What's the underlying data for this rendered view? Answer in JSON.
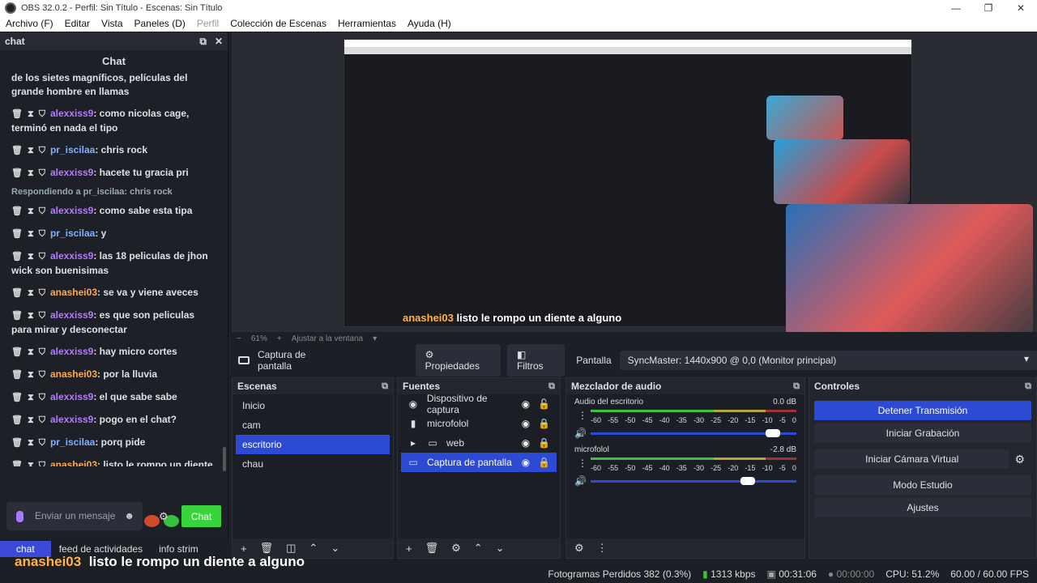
{
  "window": {
    "title": "OBS 32.0.2 - Perfil: Sin Título - Escenas: Sin Título",
    "controls": [
      "—",
      "❐",
      "✕"
    ]
  },
  "menu": [
    "Archivo (F)",
    "Editar",
    "Vista",
    "Paneles (D)",
    "Perfil",
    "Colección de Escenas",
    "Herramientas",
    "Ayuda (H)"
  ],
  "chat": {
    "dock_title": "chat",
    "title": "Chat",
    "messages": [
      {
        "user": "",
        "text": "de los sietes magníficos, películas del grande hombre en llamas"
      },
      {
        "user": "alexxiss9",
        "text": ": como nicolas cage, terminó en nada el tipo",
        "color": "u1"
      },
      {
        "user": "pr_iscilaa",
        "text": ": chris rock",
        "color": "u2"
      },
      {
        "user": "alexxiss9",
        "text": ": hacete tu gracia pri",
        "color": "u1"
      },
      {
        "user": "alexxiss9",
        "text": ": como sabe esta tipa",
        "color": "u1",
        "reply": "Respondiendo a pr_iscilaa: chris rock"
      },
      {
        "user": "pr_iscilaa",
        "text": ": y",
        "color": "u2"
      },
      {
        "user": "alexxiss9",
        "text": ": las 18 peliculas de jhon wick son buenisimas",
        "color": "u1"
      },
      {
        "user": "anashei03",
        "text": ": se va y viene aveces",
        "color": "u3"
      },
      {
        "user": "alexxiss9",
        "text": ": es que son peliculas para mirar y desconectar",
        "color": "u1"
      },
      {
        "user": "alexxiss9",
        "text": ": hay micro cortes",
        "color": "u1"
      },
      {
        "user": "anashei03",
        "text": ": por la lluvia",
        "color": "u3"
      },
      {
        "user": "alexxiss9",
        "text": ": el que sabe sabe",
        "color": "u1"
      },
      {
        "user": "alexxiss9",
        "text": ": pogo en el chat?",
        "color": "u1"
      },
      {
        "user": "pr_iscilaa",
        "text": ": porq pide",
        "color": "u2"
      },
      {
        "user": "anashei03",
        "text": ": listo le rompo un diente a alguno",
        "color": "u3"
      }
    ],
    "input_placeholder": "Enviar un mensaje",
    "send_label": "Chat",
    "tabs": [
      "chat",
      "feed de actividades",
      "info strim"
    ]
  },
  "preview": {
    "zoom": "61%",
    "fit_label": "Ajustar a la ventana",
    "overlay_user": "anashei03",
    "overlay_text": "listo le rompo un diente a alguno"
  },
  "source_toolbar": {
    "source": "Captura de pantalla",
    "props": "Propiedades",
    "filters": "Filtros",
    "display_label": "Pantalla",
    "display_value": "SyncMaster: 1440x900 @ 0,0 (Monitor principal)"
  },
  "scenes": {
    "title": "Escenas",
    "items": [
      "Inicio",
      "cam",
      "escritorio",
      "chau"
    ],
    "active": 2
  },
  "sources": {
    "title": "Fuentes",
    "items": [
      {
        "name": "Dispositivo de captura",
        "icon": "camera-icon"
      },
      {
        "name": "microfolol",
        "icon": "mic-icon"
      },
      {
        "name": "web",
        "icon": "folder-icon"
      },
      {
        "name": "Captura de pantalla",
        "icon": "monitor-icon"
      }
    ]
  },
  "mixer": {
    "title": "Mezclador de audio",
    "channels": [
      {
        "name": "Audio del escritorio",
        "db": "0.0 dB",
        "volume": 0.92
      },
      {
        "name": "microfolol",
        "db": "-2.8 dB",
        "volume": 0.8
      }
    ],
    "ticks": [
      "-60",
      "-55",
      "-50",
      "-45",
      "-40",
      "-35",
      "-30",
      "-25",
      "-20",
      "-15",
      "-10",
      "-5",
      "0"
    ]
  },
  "controls": {
    "title": "Controles",
    "items": [
      "Detener Transmisión",
      "Iniciar Grabación",
      "Iniciar Cámara Virtual",
      "Modo Estudio",
      "Ajustes"
    ]
  },
  "status": {
    "caption_user": "anashei03",
    "caption_text": "listo le rompo un diente a alguno",
    "dropped": "Fotogramas Perdidos 382 (0.3%)",
    "bitrate": "1313 kbps",
    "stream_time": "00:31:06",
    "rec_time": "00:00:00",
    "cpu": "CPU: 51.2%",
    "fps": "60.00 / 60.00 FPS"
  }
}
